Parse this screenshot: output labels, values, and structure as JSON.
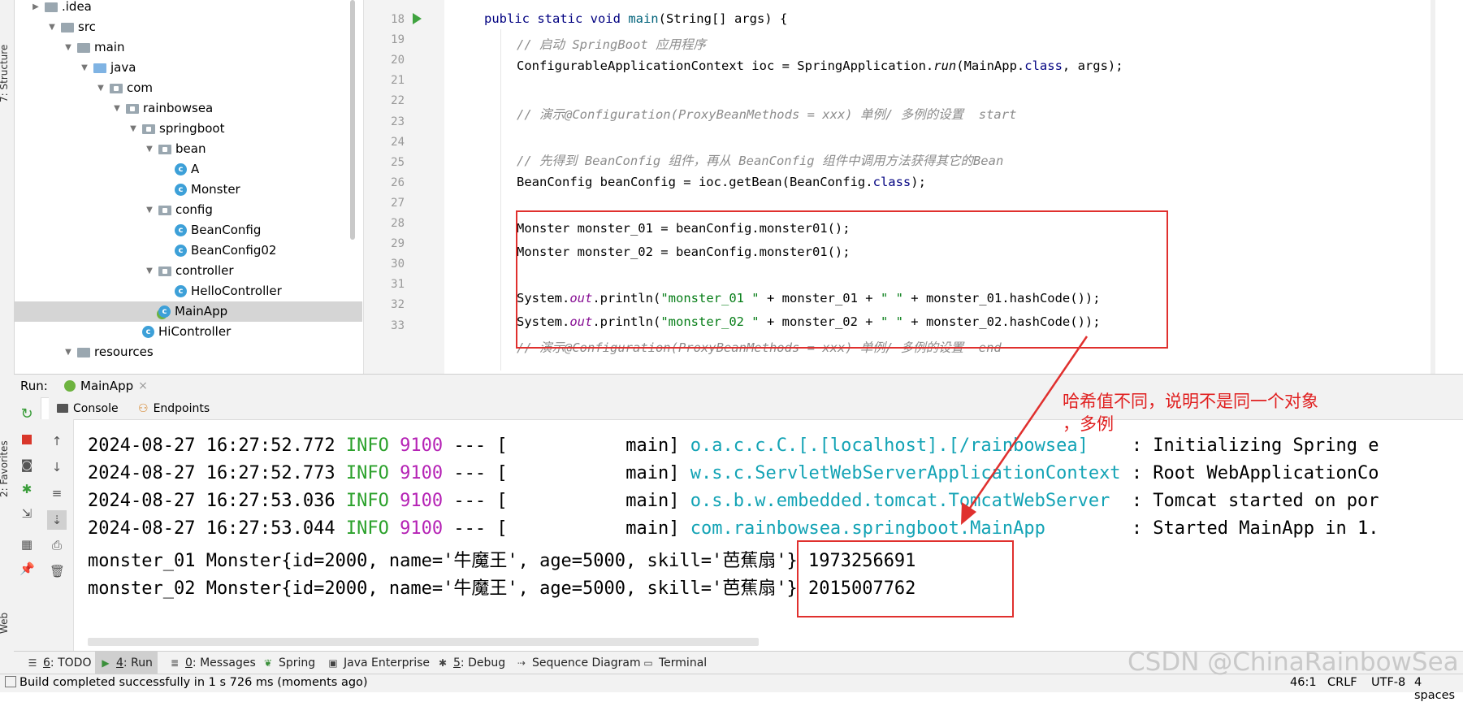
{
  "left_strip": {
    "structure_tab": "7: Structure",
    "favorites_tab": "2: Favorites",
    "web_tab": "Web"
  },
  "project_tree": [
    {
      "label": ".idea",
      "arrow": "▶",
      "icon": "folder"
    },
    {
      "label": "src",
      "arrow": "▼",
      "icon": "folder"
    },
    {
      "label": "main",
      "arrow": "▼",
      "icon": "folder"
    },
    {
      "label": "java",
      "arrow": "▼",
      "icon": "folder-blue"
    },
    {
      "label": "com",
      "arrow": "▼",
      "icon": "package"
    },
    {
      "label": "rainbowsea",
      "arrow": "▼",
      "icon": "package"
    },
    {
      "label": "springboot",
      "arrow": "▼",
      "icon": "package"
    },
    {
      "label": "bean",
      "arrow": "▼",
      "icon": "package"
    },
    {
      "label": "A",
      "arrow": "",
      "icon": "class"
    },
    {
      "label": "Monster",
      "arrow": "",
      "icon": "class"
    },
    {
      "label": "config",
      "arrow": "▼",
      "icon": "package"
    },
    {
      "label": "BeanConfig",
      "arrow": "",
      "icon": "class"
    },
    {
      "label": "BeanConfig02",
      "arrow": "",
      "icon": "class"
    },
    {
      "label": "controller",
      "arrow": "▼",
      "icon": "package"
    },
    {
      "label": "HelloController",
      "arrow": "",
      "icon": "class"
    },
    {
      "label": "MainApp",
      "arrow": "",
      "icon": "spring-class",
      "selected": true
    },
    {
      "label": "HiController",
      "arrow": "",
      "icon": "class"
    },
    {
      "label": "resources",
      "arrow": "▼",
      "icon": "folder"
    }
  ],
  "editor": {
    "line_numbers": [
      "18",
      "19",
      "20",
      "21",
      "22",
      "23",
      "24",
      "25",
      "26",
      "27",
      "28",
      "29",
      "30",
      "31",
      "32",
      "33"
    ],
    "lines": {
      "l18a": "public static void ",
      "l18b": "main",
      "l18c": "(String[] args) {",
      "l19": "// 启动 SpringBoot 应用程序",
      "l20a": "ConfigurableApplicationContext ioc = SpringApplication.",
      "l20b": "run",
      "l20c": "(MainApp.",
      "l20d": "class",
      "l20e": ", args);",
      "l22": "// 演示@Configuration(ProxyBeanMethods = xxx) 单例/ 多例的设置  start",
      "l24": "// 先得到 BeanConfig 组件，再从 BeanConfig 组件中调用方法获得其它的Bean",
      "l25a": "BeanConfig beanConfig = ioc.getBean(BeanConfig.",
      "l25b": "class",
      "l25c": ");",
      "l27": "Monster monster_01 = beanConfig.monster01();",
      "l28": "Monster monster_02 = beanConfig.monster01();",
      "l30a": "System.",
      "l30b": "out",
      "l30c": ".println(",
      "l30d": "\"monster_01 \"",
      "l30e": " + monster_01 + ",
      "l30f": "\" \"",
      "l30g": " + monster_01.hashCode());",
      "l31a": "System.",
      "l31b": "out",
      "l31c": ".println(",
      "l31d": "\"monster_02 \"",
      "l31e": " + monster_02 + ",
      "l31f": "\" \"",
      "l31g": " + monster_02.hashCode());",
      "l32": "// 演示@Configuration(ProxyBeanMethods = xxx) 单例/ 多例的设置  end"
    }
  },
  "run_panel": {
    "label": "Run:",
    "tab": "MainApp",
    "close": "×",
    "console_tab": "Console",
    "endpoints_tab": "Endpoints"
  },
  "console_lines": [
    {
      "ts": "2024-08-27 16:27:52.772",
      "level": "INFO",
      "pid": "9100",
      "sep": " --- [           main] ",
      "logger": "o.a.c.c.C.[.[localhost].[/rainbowsea]    ",
      "msg": ": Initializing Spring e"
    },
    {
      "ts": "2024-08-27 16:27:52.773",
      "level": "INFO",
      "pid": "9100",
      "sep": " --- [           main] ",
      "logger": "w.s.c.ServletWebServerApplicationContext ",
      "msg": ": Root WebApplicationCo"
    },
    {
      "ts": "2024-08-27 16:27:53.036",
      "level": "INFO",
      "pid": "9100",
      "sep": " --- [           main] ",
      "logger": "o.s.b.w.embedded.tomcat.TomcatWebServer  ",
      "msg": ": Tomcat started on por"
    },
    {
      "ts": "2024-08-27 16:27:53.044",
      "level": "INFO",
      "pid": "9100",
      "sep": " --- [           main] ",
      "logger": "com.rainbowsea.springboot.MainApp        ",
      "msg": ": Started MainApp in 1."
    }
  ],
  "console_output": [
    "monster_01 Monster{id=2000, name='牛魔王', age=5000, skill='芭蕉扇'} 1973256691",
    "monster_02 Monster{id=2000, name='牛魔王', age=5000, skill='芭蕉扇'} 2015007762"
  ],
  "annotation": {
    "line1": "哈希值不同，说明不是同一个对象",
    "line2": "，多例",
    "color": "#e02020"
  },
  "tool_tabs": [
    {
      "num": "6",
      "label": ": TODO",
      "icon": "list-icon"
    },
    {
      "num": "4",
      "label": ": Run",
      "icon": "run-icon",
      "active": true
    },
    {
      "num": "0",
      "label": ": Messages",
      "icon": "messages-icon"
    },
    {
      "num": "",
      "label": "Spring",
      "icon": "spring-icon"
    },
    {
      "num": "",
      "label": "Java Enterprise",
      "icon": "enterprise-icon"
    },
    {
      "num": "5",
      "label": ": Debug",
      "icon": "debug-icon"
    },
    {
      "num": "",
      "label": "Sequence Diagram",
      "icon": "sequence-icon"
    },
    {
      "num": "",
      "label": "Terminal",
      "icon": "terminal-icon"
    }
  ],
  "status": {
    "message": "Build completed successfully in 1 s 726 ms (moments ago)",
    "position": "46:1",
    "line_sep": "CRLF",
    "encoding": "UTF-8",
    "indent": "4 spaces"
  },
  "watermark": "CSDN @ChinaRainbowSea"
}
